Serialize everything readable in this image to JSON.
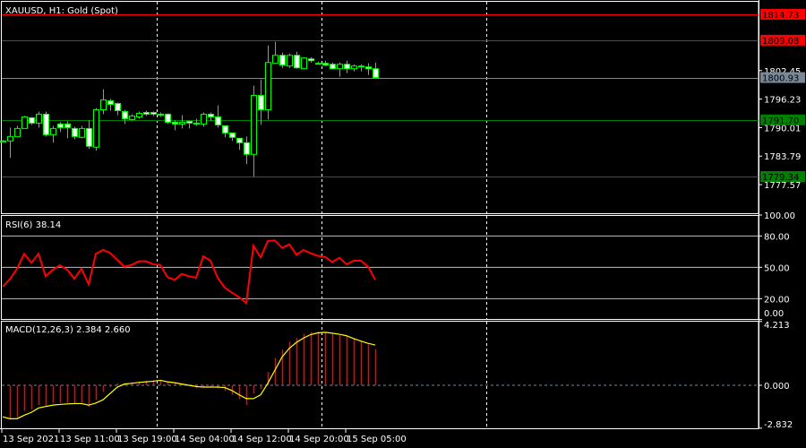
{
  "main": {
    "title": "XAUUSD, H1:  Gold (Spot)",
    "price_axis_ticks": [
      1802.45,
      1796.23,
      1790.01,
      1783.79,
      1777.57
    ],
    "price_range": [
      1771.33,
      1817.65
    ],
    "hlines": [
      {
        "price": 1814.73,
        "label": "1814.73",
        "color": "#ff0000"
      },
      {
        "price": 1809.08,
        "label": "1809.08",
        "color": "#ff0000"
      },
      {
        "price": 1800.93,
        "label": "1800.93",
        "color": "#778899"
      },
      {
        "price": 1791.7,
        "label": "1791.70",
        "color": "#008000"
      },
      {
        "price": 1779.34,
        "label": "1779.34",
        "color": "#008000"
      }
    ]
  },
  "colors": {
    "background": "#000000",
    "candle_outline": "#00ff00",
    "bull_fill": "#000000",
    "bear_fill": "#ffffff",
    "rsi": "#ff0000",
    "macd_hist": "#ff0000",
    "macd_signal": "#ffff00",
    "frame": "#ffffff",
    "separator": "#ffffff"
  },
  "chart_data": [
    {
      "type": "candlestick",
      "title": "XAUUSD, H1:  Gold (Spot)",
      "ohlc": [
        [
          1787.1,
          1787.3,
          1786.9,
          1787.1
        ],
        [
          1787.1,
          1790.02,
          1783.4,
          1788.07
        ],
        [
          1788.07,
          1790.41,
          1787.88,
          1789.82
        ],
        [
          1789.82,
          1792.55,
          1789.82,
          1792.35
        ],
        [
          1792.16,
          1792.35,
          1790.6,
          1790.99
        ],
        [
          1790.99,
          1793.52,
          1790.02,
          1792.94
        ],
        [
          1792.94,
          1793.52,
          1788.07,
          1788.46
        ],
        [
          1788.46,
          1790.41,
          1786.71,
          1789.82
        ],
        [
          1790.8,
          1791.18,
          1789.04,
          1790.02
        ],
        [
          1790.8,
          1791.38,
          1787.68,
          1790.02
        ],
        [
          1789.82,
          1790.21,
          1787.49,
          1788.07
        ],
        [
          1787.88,
          1790.41,
          1787.68,
          1789.82
        ],
        [
          1789.82,
          1791.57,
          1785.35,
          1785.93
        ],
        [
          1785.74,
          1794.3,
          1784.96,
          1793.91
        ],
        [
          1793.91,
          1798.38,
          1792.94,
          1796.05
        ],
        [
          1795.85,
          1796.24,
          1793.71,
          1795.08
        ],
        [
          1795.27,
          1795.47,
          1792.74,
          1793.71
        ],
        [
          1793.52,
          1793.91,
          1790.8,
          1791.96
        ],
        [
          1791.77,
          1792.94,
          1791.57,
          1792.55
        ],
        [
          1792.35,
          1793.52,
          1791.96,
          1793.13
        ],
        [
          1793.32,
          1793.71,
          1792.55,
          1792.94
        ],
        [
          1793.32,
          1793.52,
          1792.55,
          1792.94
        ],
        [
          1792.94,
          1793.32,
          1792.35,
          1792.94
        ],
        [
          1792.94,
          1793.13,
          1790.8,
          1791.18
        ],
        [
          1791.18,
          1791.57,
          1789.43,
          1790.8
        ],
        [
          1790.8,
          1792.74,
          1789.82,
          1791.18
        ],
        [
          1791.38,
          1791.38,
          1789.82,
          1790.99
        ],
        [
          1790.99,
          1791.96,
          1790.41,
          1790.8
        ],
        [
          1790.8,
          1793.32,
          1790.21,
          1792.94
        ],
        [
          1792.94,
          1793.32,
          1791.38,
          1792.35
        ],
        [
          1792.35,
          1794.88,
          1790.02,
          1790.6
        ],
        [
          1790.41,
          1790.41,
          1787.88,
          1788.85
        ],
        [
          1788.85,
          1788.85,
          1787.1,
          1787.88
        ],
        [
          1787.68,
          1787.68,
          1785.15,
          1786.71
        ],
        [
          1786.71,
          1788.07,
          1782.04,
          1784.18
        ],
        [
          1784.18,
          1799.16,
          1779.31,
          1797.02
        ],
        [
          1797.02,
          1800.53,
          1790.6,
          1793.91
        ],
        [
          1793.91,
          1807.92,
          1791.77,
          1804.22
        ],
        [
          1804.03,
          1808.7,
          1804.03,
          1805.78
        ],
        [
          1805.78,
          1806.36,
          1803.05,
          1803.64
        ],
        [
          1803.44,
          1806.17,
          1803.05,
          1805.78
        ],
        [
          1805.78,
          1806.56,
          1802.86,
          1803.05
        ],
        [
          1802.86,
          1805.39,
          1802.67,
          1805.2
        ],
        [
          1805.0,
          1805.39,
          1804.22,
          1804.61
        ],
        [
          1804.03,
          1804.42,
          1803.83,
          1804.03
        ],
        [
          1804.03,
          1804.61,
          1803.44,
          1803.64
        ],
        [
          1803.83,
          1804.22,
          1802.67,
          1802.86
        ],
        [
          1802.86,
          1804.22,
          1801.11,
          1803.83
        ],
        [
          1803.83,
          1804.61,
          1801.89,
          1802.86
        ],
        [
          1802.86,
          1803.83,
          1802.28,
          1803.44
        ],
        [
          1803.44,
          1803.83,
          1802.28,
          1803.25
        ],
        [
          1803.25,
          1804.03,
          1801.5,
          1802.86
        ],
        [
          1802.86,
          1804.22,
          1800.72,
          1800.93
        ]
      ],
      "ylim": [
        1771.33,
        1817.65
      ],
      "x_tick_labels": [
        {
          "label": "13 Sep 2021",
          "bar": 0
        },
        {
          "label": "13 Sep 11:00",
          "bar": 8
        },
        {
          "label": "13 Sep 19:00",
          "bar": 16
        },
        {
          "label": "14 Sep 04:00",
          "bar": 24
        },
        {
          "label": "14 Sep 12:00",
          "bar": 32
        },
        {
          "label": "14 Sep 20:00",
          "bar": 40
        },
        {
          "label": "15 Sep 05:00",
          "bar": 48
        }
      ],
      "period_separator_bars": [
        21,
        44,
        67
      ]
    },
    {
      "type": "line",
      "title": "RSI(6) 38.14",
      "ylim": [
        0,
        100
      ],
      "levels": [
        80,
        50,
        20
      ],
      "axis_ticks": [
        "100.00",
        "80.00",
        "50.00",
        "20.00",
        "0.00"
      ],
      "values": [
        31.4,
        38.6,
        48.6,
        62.9,
        54.3,
        62.9,
        41.4,
        47.7,
        52.0,
        47.7,
        39.1,
        48.6,
        33.7,
        62.9,
        66.6,
        63.7,
        57.1,
        50.6,
        52.3,
        55.7,
        55.7,
        52.9,
        52.3,
        40.6,
        38.0,
        43.7,
        41.4,
        40.0,
        60.6,
        56.3,
        40.0,
        30.6,
        25.7,
        21.4,
        15.7,
        70.6,
        59.4,
        75.1,
        75.7,
        68.6,
        72.0,
        62.0,
        66.6,
        63.4,
        60.9,
        60.0,
        55.1,
        59.1,
        52.9,
        56.3,
        56.3,
        50.6,
        38.14
      ]
    },
    {
      "type": "bar+line",
      "title": "MACD(12,26,3) 2.384 2.660",
      "ylim": [
        -2.832,
        4.213
      ],
      "axis_ticks": [
        "4.213",
        "0.000",
        "-2.832"
      ],
      "histogram": [
        -2.15,
        -2.17,
        -2.12,
        -1.69,
        -1.6,
        -1.31,
        -1.37,
        -1.15,
        -1.17,
        -1.15,
        -1.21,
        -1.15,
        -1.42,
        -0.96,
        -0.44,
        -0.12,
        0.13,
        0.13,
        0.19,
        0.23,
        0.29,
        0.33,
        0.33,
        0.23,
        0.13,
        0.08,
        -0.06,
        -0.19,
        -0.12,
        -0.12,
        -0.19,
        -0.38,
        -0.63,
        -0.92,
        -1.31,
        -0.54,
        -0.25,
        0.88,
        1.81,
        2.35,
        2.88,
        3.12,
        3.4,
        3.5,
        3.54,
        3.5,
        3.38,
        3.31,
        3.21,
        3.12,
        2.88,
        2.69,
        2.384
      ],
      "signal": [
        -2.08,
        -2.21,
        -2.21,
        -1.98,
        -1.79,
        -1.5,
        -1.4,
        -1.31,
        -1.27,
        -1.23,
        -1.21,
        -1.21,
        -1.31,
        -1.17,
        -0.96,
        -0.54,
        -0.12,
        0.08,
        0.13,
        0.19,
        0.23,
        0.27,
        0.33,
        0.23,
        0.17,
        0.08,
        0.0,
        -0.08,
        -0.12,
        -0.12,
        -0.12,
        -0.15,
        -0.35,
        -0.63,
        -0.88,
        -0.88,
        -0.63,
        0.13,
        1.0,
        1.87,
        2.44,
        2.83,
        3.12,
        3.35,
        3.46,
        3.5,
        3.44,
        3.37,
        3.27,
        3.08,
        2.92,
        2.77,
        2.66
      ]
    }
  ]
}
